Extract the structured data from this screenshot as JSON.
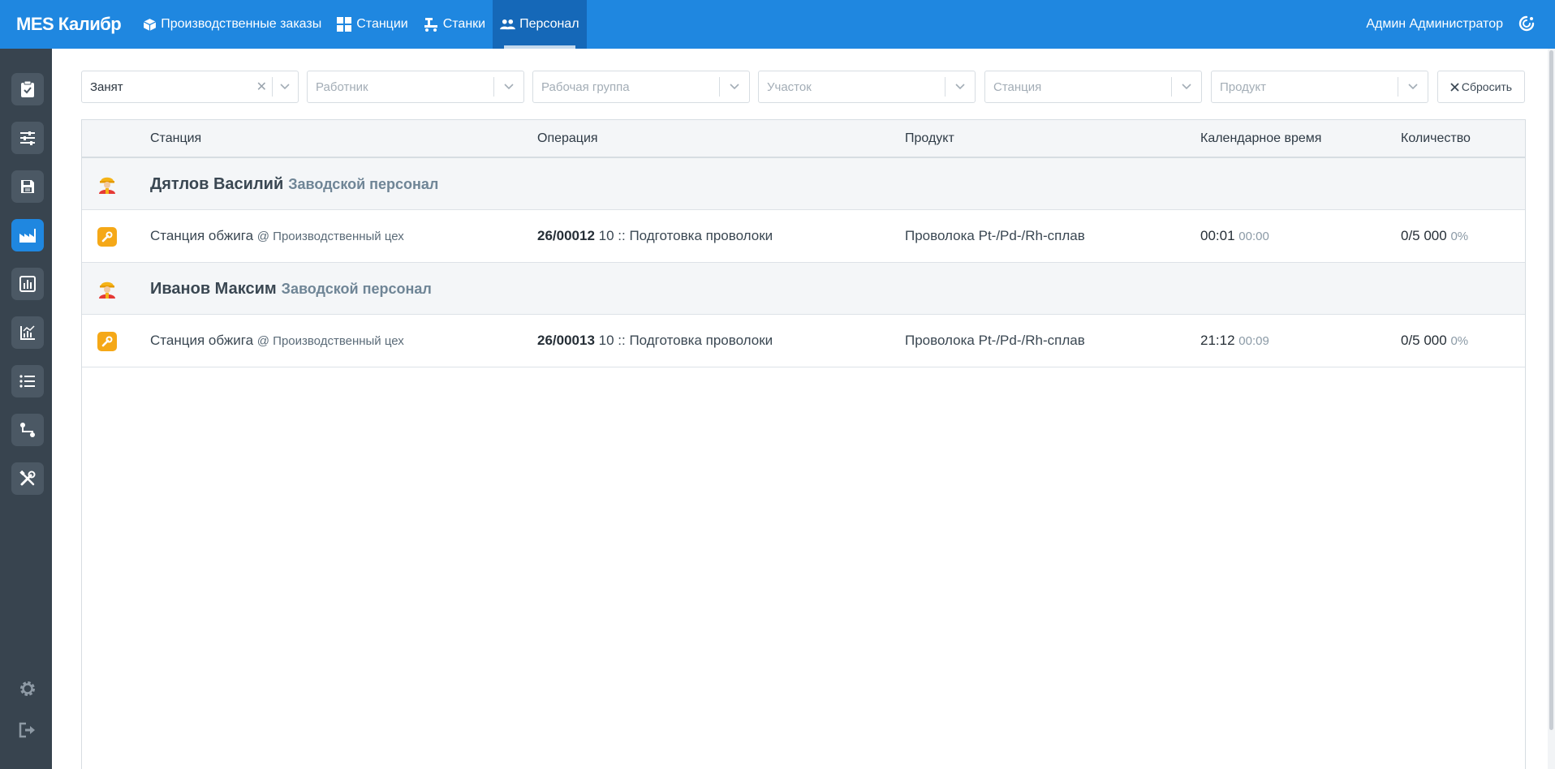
{
  "app": {
    "brand": "MES Калибр",
    "user_name": "Админ Администратор"
  },
  "nav": {
    "orders": "Производственные заказы",
    "stations": "Станции",
    "machines": "Станки",
    "personnel": "Персонал"
  },
  "filters": {
    "status": {
      "value": "Занят",
      "placeholder": ""
    },
    "worker": {
      "placeholder": "Работник"
    },
    "group": {
      "placeholder": "Рабочая группа"
    },
    "area": {
      "placeholder": "Участок"
    },
    "station": {
      "placeholder": "Станция"
    },
    "product": {
      "placeholder": "Продукт"
    },
    "reset_label": "Сбросить"
  },
  "table": {
    "columns": {
      "station": "Станция",
      "operation": "Операция",
      "product": "Продукт",
      "time": "Календарное время",
      "qty": "Количество"
    },
    "groups": [
      {
        "name": "Дятлов Василий",
        "role": "Заводской персонал",
        "row": {
          "station": "Станция обжига",
          "location": "@ Производственный цех",
          "order": "26/00012",
          "operation": "10 :: Подготовка проволоки",
          "product": "Проволока Pt-/Pd-/Rh-сплав",
          "time_main": "00:01",
          "time_sub": "00:00",
          "qty_main": "0/5 000",
          "qty_pct": "0%"
        }
      },
      {
        "name": "Иванов Максим",
        "role": "Заводской персонал",
        "row": {
          "station": "Станция обжига",
          "location": "@ Производственный цех",
          "order": "26/00013",
          "operation": "10 :: Подготовка проволоки",
          "product": "Проволока Pt-/Pd-/Rh-сплав",
          "time_main": "21:12",
          "time_sub": "00:09",
          "qty_main": "0/5 000",
          "qty_pct": "0%"
        }
      }
    ]
  },
  "colors": {
    "primary": "#1f87e0",
    "sidebar": "#38444f",
    "accent_orange": "#f5a817"
  },
  "icons": {
    "sidebar": [
      "clipboard-check-icon",
      "sliders-icon",
      "save-icon",
      "factory-icon",
      "bar-chart-icon",
      "line-chart-icon",
      "list-icon",
      "route-icon",
      "tools-icon",
      "settings-icon",
      "logout-icon"
    ]
  }
}
